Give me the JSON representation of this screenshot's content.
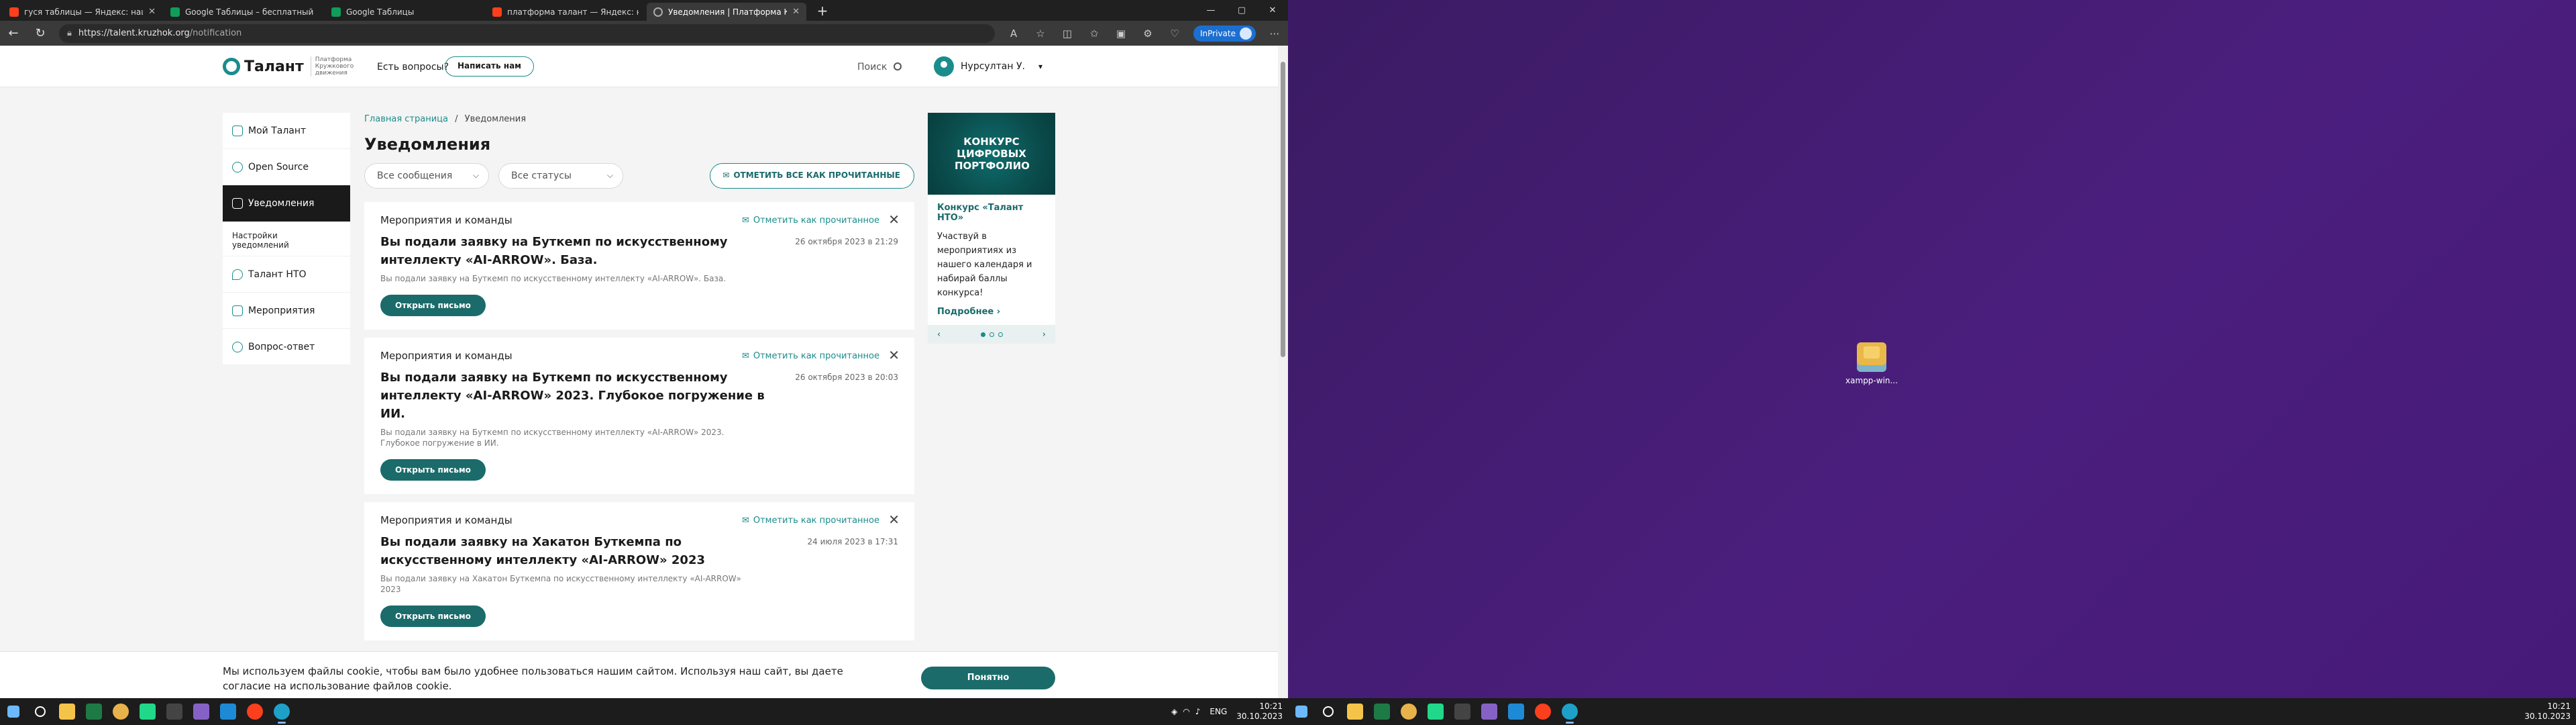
{
  "browser": {
    "tabs": [
      {
        "title": "гуся таблицы — Яндекс: нашл",
        "color": "#fc3f1d"
      },
      {
        "title": "Google Таблицы – бесплатный",
        "color": "#0f9d58"
      },
      {
        "title": "Google Таблицы",
        "color": "#0f9d58"
      },
      {
        "title": "платформа талант — Яндекс: н",
        "color": "#fc3f1d"
      },
      {
        "title": "Уведомления | Платформа Кру",
        "color": "#888888"
      }
    ],
    "url_host": "https://talent.kruzhok.org",
    "url_path": "/notification",
    "inprivate": "InPrivate",
    "window_controls": {
      "min": "—",
      "max": "▢",
      "close": "✕"
    }
  },
  "site": {
    "logo_name": "Талант",
    "logo_sub": "Платформа Кружкового движения",
    "question": "Есть вопросы?",
    "write_btn": "Написать нам",
    "search": "Поиск",
    "user_name": "Нурсултан У."
  },
  "sidebar": {
    "items": [
      {
        "label": "Мой Талант"
      },
      {
        "label": "Open Source"
      },
      {
        "label": "Уведомления"
      },
      {
        "label": "Настройки уведомлений"
      },
      {
        "label": "Талант НТО"
      },
      {
        "label": "Мероприятия"
      },
      {
        "label": "Вопрос-ответ"
      }
    ]
  },
  "content": {
    "breadcrumb_home": "Главная страница",
    "breadcrumb_sep": "/",
    "breadcrumb_current": "Уведомления",
    "title": "Уведомления",
    "filter_messages": "Все сообщения",
    "filter_status": "Все статусы",
    "mark_all": "ОТМЕТИТЬ ВСЕ КАК ПРОЧИТАННЫЕ",
    "cards": [
      {
        "category": "Мероприятия и команды",
        "mark": "Отметить как прочитанное",
        "title": "Вы подали заявку на Буткемп по искусственному интеллекту «AI-ARROW». База.",
        "date": "26 октября 2023 в 21:29",
        "desc": "Вы подали заявку на Буткемп по искусственному интеллекту «AI-ARROW». База.",
        "button": "Открыть письмо"
      },
      {
        "category": "Мероприятия и команды",
        "mark": "Отметить как прочитанное",
        "title": "Вы подали заявку на Буткемп по искусственному интеллекту «AI-ARROW» 2023. Глубокое погружение в ИИ.",
        "date": "26 октября 2023 в 20:03",
        "desc": "Вы подали заявку на Буткемп по искусственному интеллекту «AI-ARROW» 2023. Глубокое погружение в ИИ.",
        "button": "Открыть письмо"
      },
      {
        "category": "Мероприятия и команды",
        "mark": "Отметить как прочитанное",
        "title": "Вы подали заявку на Хакатон Буткемпа по искусственному интеллекту «AI-ARROW» 2023",
        "date": "24 июля 2023 в 17:31",
        "desc": "Вы подали заявку на Хакатон Буткемпа по искусственному интеллекту «AI-ARROW» 2023",
        "button": "Открыть письмо"
      }
    ]
  },
  "promo": {
    "image_text": "КОНКУРС ЦИФРОВЫХ ПОРТФОЛИО",
    "title": "Конкурс «Талант НТО»",
    "text": "Участвуй в мероприятиях из нашего календаря и набирай баллы конкурса!",
    "more": "Подробнее",
    "prev": "‹",
    "next": "›"
  },
  "cookie": {
    "text": "Мы используем файлы cookie, чтобы вам было удобнее пользоваться нашим сайтом. Используя наш сайт, вы даете согласие на использование файлов cookie.",
    "button": "Понятно"
  },
  "desktop": {
    "icon_label": "xampp-win..."
  },
  "taskbar": {
    "lang": "ENG",
    "time": "10:21",
    "date": "30.10.2023",
    "time2": "10:21",
    "date2": "30.10.2023"
  }
}
